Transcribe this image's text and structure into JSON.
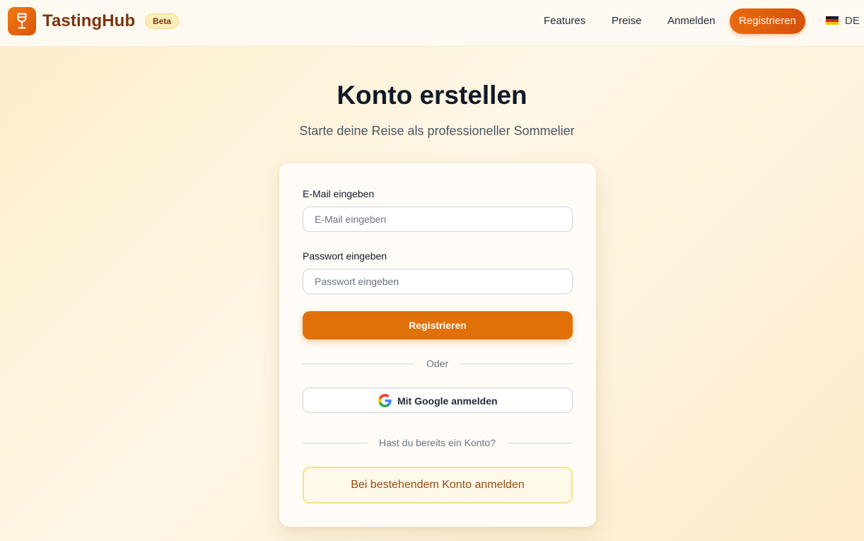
{
  "header": {
    "brand": "TastingHub",
    "badge": "Beta",
    "nav": {
      "features": "Features",
      "pricing": "Preise",
      "login": "Anmelden",
      "register": "Registrieren"
    },
    "language": "DE",
    "logo_icon": "wine-glass-icon",
    "flag_icon": "germany-flag-icon"
  },
  "page": {
    "title": "Konto erstellen",
    "subtitle": "Starte deine Reise als professioneller Sommelier"
  },
  "form": {
    "email_label": "E-Mail eingeben",
    "email_placeholder": "E-Mail eingeben",
    "email_value": "",
    "password_label": "Passwort eingeben",
    "password_placeholder": "Passwort eingeben",
    "password_value": "",
    "submit_label": "Registrieren",
    "or_label": "Oder",
    "google_label": "Mit Google anmelden",
    "google_icon": "google-logo-icon",
    "existing_account_text": "Hast du bereits ein Konto?",
    "login_button_label": "Bei bestehendem Konto anmelden"
  },
  "colors": {
    "accent": "#e17008",
    "brand_text": "#7c3412",
    "badge_bg": "#fdefb9",
    "login_button_border": "#f9e08a"
  }
}
